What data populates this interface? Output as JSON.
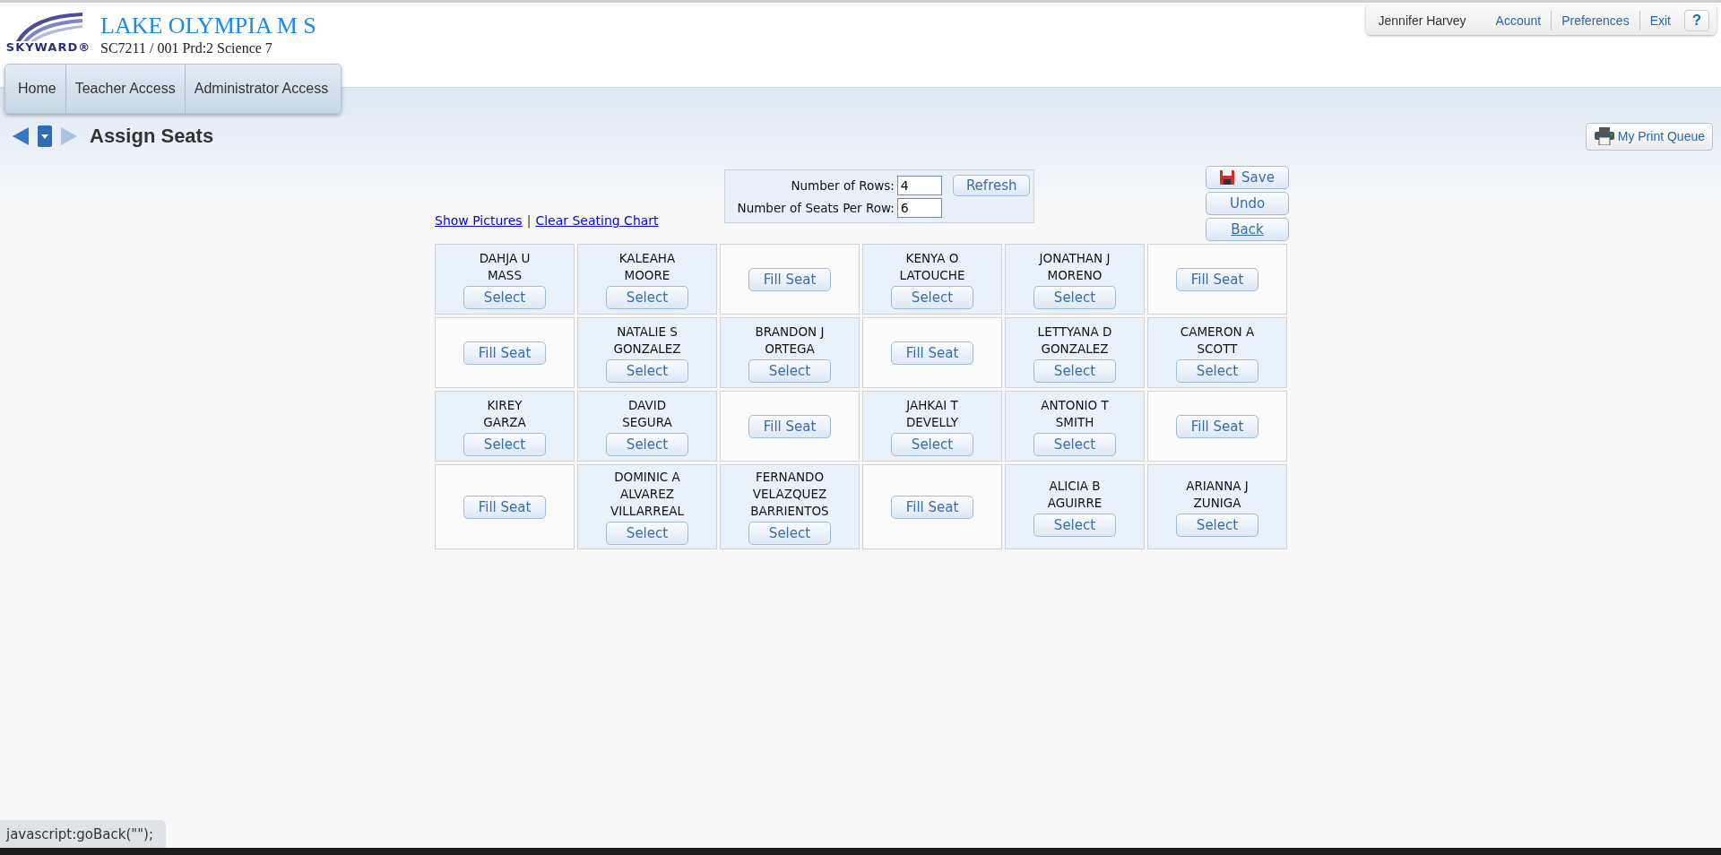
{
  "header": {
    "logo_text": "SKYWARD®",
    "school": "LAKE OLYMPIA M S",
    "course": "SC7211 / 001 Prd:2 Science 7"
  },
  "nav": [
    {
      "label": "Home"
    },
    {
      "label": "Teacher Access"
    },
    {
      "label": "Administrator Access"
    }
  ],
  "user_menu": {
    "user": "Jennifer Harvey",
    "links": [
      "Account",
      "Preferences",
      "Exit"
    ],
    "help": "?"
  },
  "page_title": "Assign Seats",
  "print_queue": "My Print Queue",
  "links": {
    "show_pictures": "Show Pictures",
    "separator": "|",
    "clear": "Clear Seating Chart"
  },
  "settings": {
    "rows_label": "Number of Rows:",
    "rows_value": "4",
    "refresh": "Refresh",
    "seats_label": "Number of Seats Per Row:",
    "seats_value": "6"
  },
  "actions": {
    "save": "Save",
    "undo": "Undo",
    "back": "Back"
  },
  "seats": [
    [
      {
        "kind": "student",
        "lines": [
          "DAHJA U",
          "MASS"
        ],
        "button": "Select"
      },
      {
        "kind": "student",
        "lines": [
          "KALEAHA",
          "MOORE"
        ],
        "button": "Select"
      },
      {
        "kind": "empty",
        "button": "Fill Seat"
      },
      {
        "kind": "student",
        "lines": [
          "KENYA O",
          "LATOUCHE"
        ],
        "button": "Select"
      },
      {
        "kind": "student",
        "lines": [
          "JONATHAN J",
          "MORENO"
        ],
        "button": "Select"
      },
      {
        "kind": "empty",
        "button": "Fill Seat"
      }
    ],
    [
      {
        "kind": "empty",
        "button": "Fill Seat"
      },
      {
        "kind": "student",
        "lines": [
          "NATALIE S",
          "GONZALEZ"
        ],
        "button": "Select"
      },
      {
        "kind": "student",
        "lines": [
          "BRANDON J",
          "ORTEGA"
        ],
        "button": "Select"
      },
      {
        "kind": "empty",
        "button": "Fill Seat"
      },
      {
        "kind": "student",
        "lines": [
          "LETTYANA D",
          "GONZALEZ"
        ],
        "button": "Select"
      },
      {
        "kind": "student",
        "lines": [
          "CAMERON A",
          "SCOTT"
        ],
        "button": "Select"
      }
    ],
    [
      {
        "kind": "student",
        "lines": [
          "KIREY",
          "GARZA"
        ],
        "button": "Select"
      },
      {
        "kind": "student",
        "lines": [
          "DAVID",
          "SEGURA"
        ],
        "button": "Select"
      },
      {
        "kind": "empty",
        "button": "Fill Seat"
      },
      {
        "kind": "student",
        "lines": [
          "JAHKAI T",
          "DEVELLY"
        ],
        "button": "Select"
      },
      {
        "kind": "student",
        "lines": [
          "ANTONIO T",
          "SMITH"
        ],
        "button": "Select"
      },
      {
        "kind": "empty",
        "button": "Fill Seat"
      }
    ],
    [
      {
        "kind": "empty",
        "button": "Fill Seat"
      },
      {
        "kind": "student",
        "lines": [
          "DOMINIC A",
          "ALVAREZ",
          "VILLARREAL"
        ],
        "button": "Select"
      },
      {
        "kind": "student",
        "lines": [
          "FERNANDO",
          "VELAZQUEZ",
          "BARRIENTOS"
        ],
        "button": "Select"
      },
      {
        "kind": "empty",
        "button": "Fill Seat"
      },
      {
        "kind": "student",
        "lines": [
          "ALICIA B",
          "AGUIRRE"
        ],
        "button": "Select"
      },
      {
        "kind": "student",
        "lines": [
          "ARIANNA J",
          "ZUNIGA"
        ],
        "button": "Select"
      }
    ]
  ],
  "status_text": "javascript:goBack(\"\");"
}
